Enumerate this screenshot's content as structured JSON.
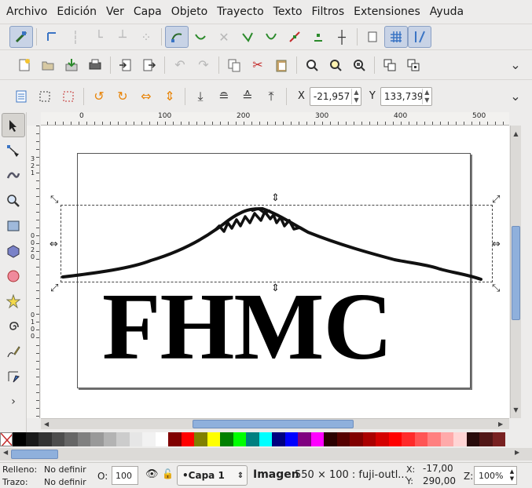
{
  "menu": [
    "Archivo",
    "Edición",
    "Ver",
    "Capa",
    "Objeto",
    "Trayecto",
    "Texto",
    "Filtros",
    "Extensiones",
    "Ayuda"
  ],
  "toolbar": {
    "x_label": "X",
    "x_value": "-21,957",
    "y_label": "Y",
    "y_value": "133,739"
  },
  "rulers": {
    "h_labels": [
      "0",
      "100",
      "200",
      "300",
      "400",
      "500"
    ],
    "v_labels": [
      "3",
      "2",
      "1",
      "0",
      "0",
      "2",
      "0",
      "0",
      "1",
      "0",
      "0"
    ]
  },
  "canvas": {
    "logo_text": "FHMC"
  },
  "palette": [
    "#000000",
    "#1a1a1a",
    "#333333",
    "#4d4d4d",
    "#666666",
    "#808080",
    "#999999",
    "#b3b3b3",
    "#cccccc",
    "#e6e6e6",
    "#f2f2f2",
    "#ffffff",
    "#800000",
    "#ff0000",
    "#808000",
    "#ffff00",
    "#008000",
    "#00ff00",
    "#008080",
    "#00ffff",
    "#000080",
    "#0000ff",
    "#800080",
    "#ff00ff",
    "#2b0000",
    "#550000",
    "#800000",
    "#aa0000",
    "#d40000",
    "#ff0000",
    "#ff2a2a",
    "#ff5555",
    "#ff8080",
    "#ffaaaa",
    "#ffd5d5",
    "#280b0b",
    "#501616",
    "#782121"
  ],
  "status": {
    "fill_label": "Relleno:",
    "fill_value": "No definir",
    "stroke_label": "Trazo:",
    "stroke_value": "No definir",
    "opacity_label": "O:",
    "opacity_value": "100",
    "layer": "•Capa 1",
    "message_bold": "Imagen",
    "message_rest": " 550 × 100 : fuji-outl...",
    "x_label": "X:",
    "x_value": "-17,00",
    "y_label": "Y:",
    "y_value": "290,00",
    "zoom_label": "Z:",
    "zoom_value": "100%"
  }
}
